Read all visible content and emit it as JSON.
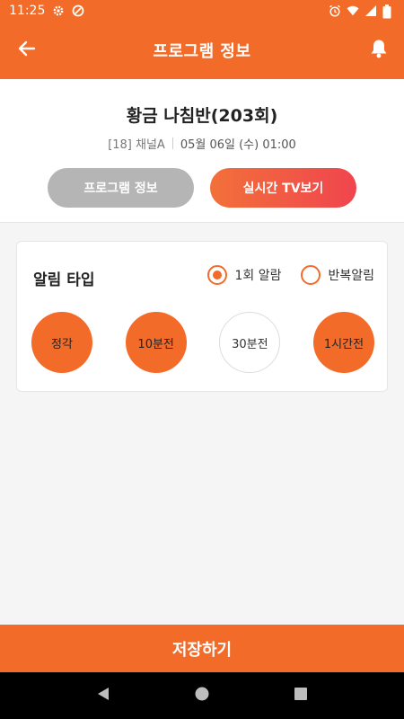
{
  "status_bar": {
    "time": "11:25",
    "icons": [
      "gear-icon",
      "vpn-icon",
      "alarm-clock-icon",
      "wifi-icon",
      "signal-icon",
      "battery-icon"
    ]
  },
  "app_bar": {
    "title": "프로그램 정보",
    "back_icon": "arrow-left-icon",
    "bell_icon": "bell-icon"
  },
  "program": {
    "title": "황금 나침반(203회)",
    "channel": "[18] 채널A",
    "datetime": "05월 06일 (수) 01:00"
  },
  "buttons": {
    "info": "프로그램 정보",
    "live": "실시간 TV보기"
  },
  "alarm": {
    "label": "알림 타입",
    "options": [
      {
        "label": "1회 알람",
        "checked": true
      },
      {
        "label": "반복알림",
        "checked": false
      }
    ],
    "times": [
      {
        "label": "정각",
        "selected": true
      },
      {
        "label": "10분전",
        "selected": true
      },
      {
        "label": "30분전",
        "selected": false
      },
      {
        "label": "1시간전",
        "selected": true
      }
    ]
  },
  "save_label": "저장하기",
  "colors": {
    "primary": "#f26b28",
    "live_gradient_start": "#f2703a",
    "live_gradient_end": "#f0454e",
    "gray_button": "#b5b5b5"
  },
  "nav_bar": {
    "icons": [
      "back-triangle-icon",
      "home-circle-icon",
      "recents-square-icon"
    ]
  }
}
